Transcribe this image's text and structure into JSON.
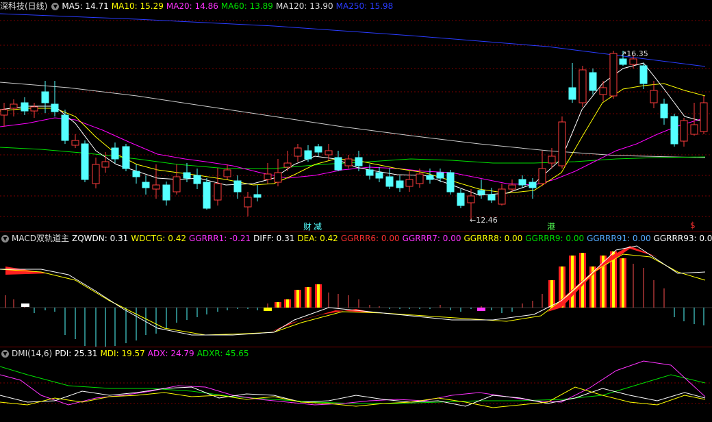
{
  "colors": {
    "up": "#ff3c3c",
    "down": "#54ffff",
    "ma5": "#ffffff",
    "ma10": "#ffff00",
    "ma20": "#ff00ff",
    "ma60": "#00e000",
    "ma120": "#cccccc",
    "ma250": "#2a3cff",
    "grid": "#7a0000"
  },
  "main_panel": {
    "stock_name": "深科技(日线)",
    "dropdown_icon": "chevron-down-icon",
    "indicators": [
      {
        "label": "MA5: 14.71",
        "color": "#ffffff"
      },
      {
        "label": "MA10: 15.29",
        "color": "#ffff00"
      },
      {
        "label": "MA20: 14.86",
        "color": "#ff33ff"
      },
      {
        "label": "MA60: 13.89",
        "color": "#00e000"
      },
      {
        "label": "MA120: 13.90",
        "color": "#dddddd"
      },
      {
        "label": "MA250: 15.98",
        "color": "#2a3cff"
      }
    ],
    "high_marker": "16.35",
    "low_marker": "12.46",
    "event_markers": [
      "财",
      "减",
      "港",
      "$"
    ]
  },
  "macd_panel": {
    "title": "MACD双轨道主",
    "indicators": [
      {
        "label": "ZQWDN: 0.31",
        "color": "#ffffff"
      },
      {
        "label": "WDCTG: 0.42",
        "color": "#ffff00"
      },
      {
        "label": "GGRRR1: -0.21",
        "color": "#ff33ff"
      },
      {
        "label": "DIFF: 0.31",
        "color": "#ffffff"
      },
      {
        "label": "DEA: 0.42",
        "color": "#ffff00"
      },
      {
        "label": "GGRRR6: 0.00",
        "color": "#ff3030"
      },
      {
        "label": "GGRRR7: 0.00",
        "color": "#ff33ff"
      },
      {
        "label": "GGRRR8: 0.00",
        "color": "#ffff00"
      },
      {
        "label": "GGRRR9: 0.00",
        "color": "#00e000"
      },
      {
        "label": "GGRRR91: 0.00",
        "color": "#54aaff"
      },
      {
        "label": "GGRRR93: 0.00",
        "color": "#ffffff"
      }
    ]
  },
  "dmi_panel": {
    "title": "DMI(14,6)",
    "indicators": [
      {
        "label": "PDI: 25.31",
        "color": "#ffffff"
      },
      {
        "label": "MDI: 19.57",
        "color": "#ffff00"
      },
      {
        "label": "ADX: 24.79",
        "color": "#ff33ff"
      },
      {
        "label": "ADXR: 45.65",
        "color": "#00e000"
      }
    ]
  }
}
